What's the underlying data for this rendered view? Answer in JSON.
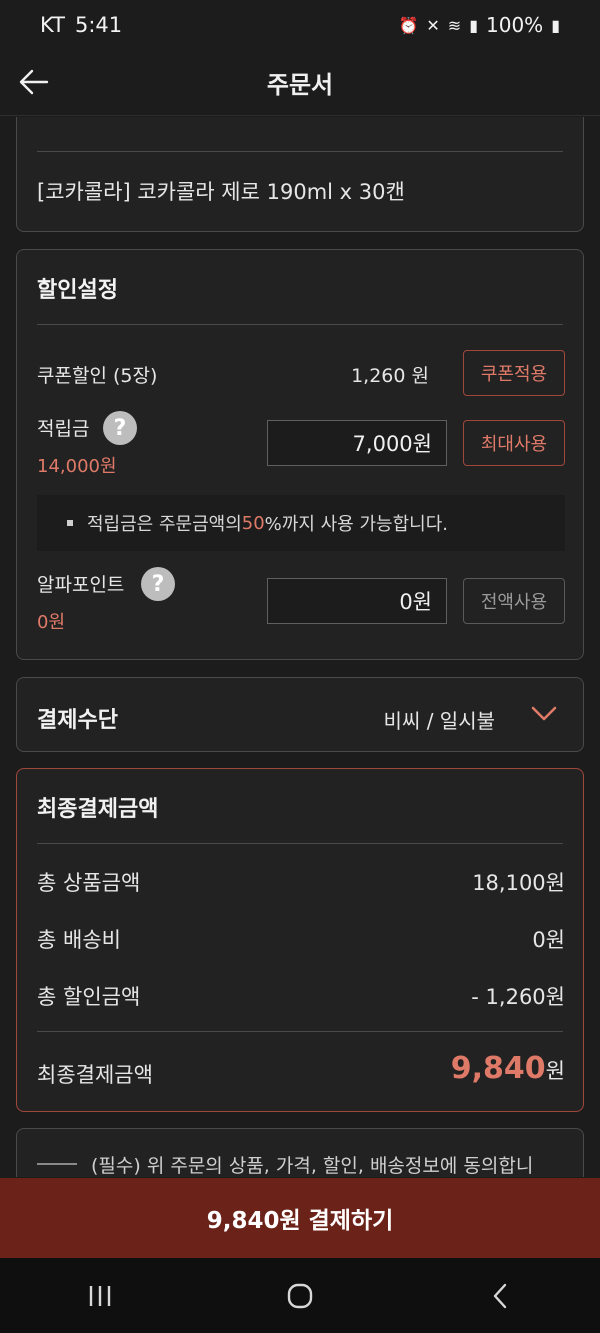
{
  "status_bar": {
    "carrier": "KT",
    "time": "5:41",
    "battery": "100%"
  },
  "header": {
    "title": "주문서"
  },
  "product_card": {
    "product_name": "[코카콜라] 코카콜라 제로 190ml x 30캔"
  },
  "discount": {
    "title": "할인설정",
    "coupon_label": "쿠폰할인 (5장)",
    "coupon_amount": "1,260 원",
    "coupon_button": "쿠폰적용",
    "points_label": "적립금",
    "points_balance": "14,000원",
    "points_input": "7,000원",
    "points_button": "최대사용",
    "notice_prefix": "적립금은 주문금액의 ",
    "notice_accent": "50",
    "notice_suffix": "%까지 사용 가능합니다.",
    "alpha_label": "알파포인트",
    "alpha_balance": "0원",
    "alpha_input": "0원",
    "alpha_button": "전액사용",
    "help_glyph": "?"
  },
  "payment_method": {
    "title": "결제수단",
    "value": "비씨 / 일시불"
  },
  "final": {
    "title": "최종결제금액",
    "rows": [
      {
        "label": "총 상품금액",
        "value": "18,100원"
      },
      {
        "label": "총 배송비",
        "value": "0원"
      },
      {
        "label": "총 할인금액",
        "value": "- 1,260원"
      }
    ],
    "total_label": "최종결제금액",
    "total_value": "9,840",
    "total_unit": "원"
  },
  "agreement": {
    "text": "(필수) 위 주문의 상품, 가격, 할인, 배송정보에 동의합니"
  },
  "pay_button": {
    "label": "9,840원 결제하기"
  },
  "colors": {
    "accent": "#e07a68",
    "pay_bar": "#6b2219",
    "background": "#1c1c1c"
  },
  "icons": {
    "back": "arrow-left-icon",
    "dropdown": "chevron-down-icon",
    "nav_recent": "recent-apps-icon",
    "nav_home": "home-icon",
    "nav_back": "nav-back-icon"
  }
}
